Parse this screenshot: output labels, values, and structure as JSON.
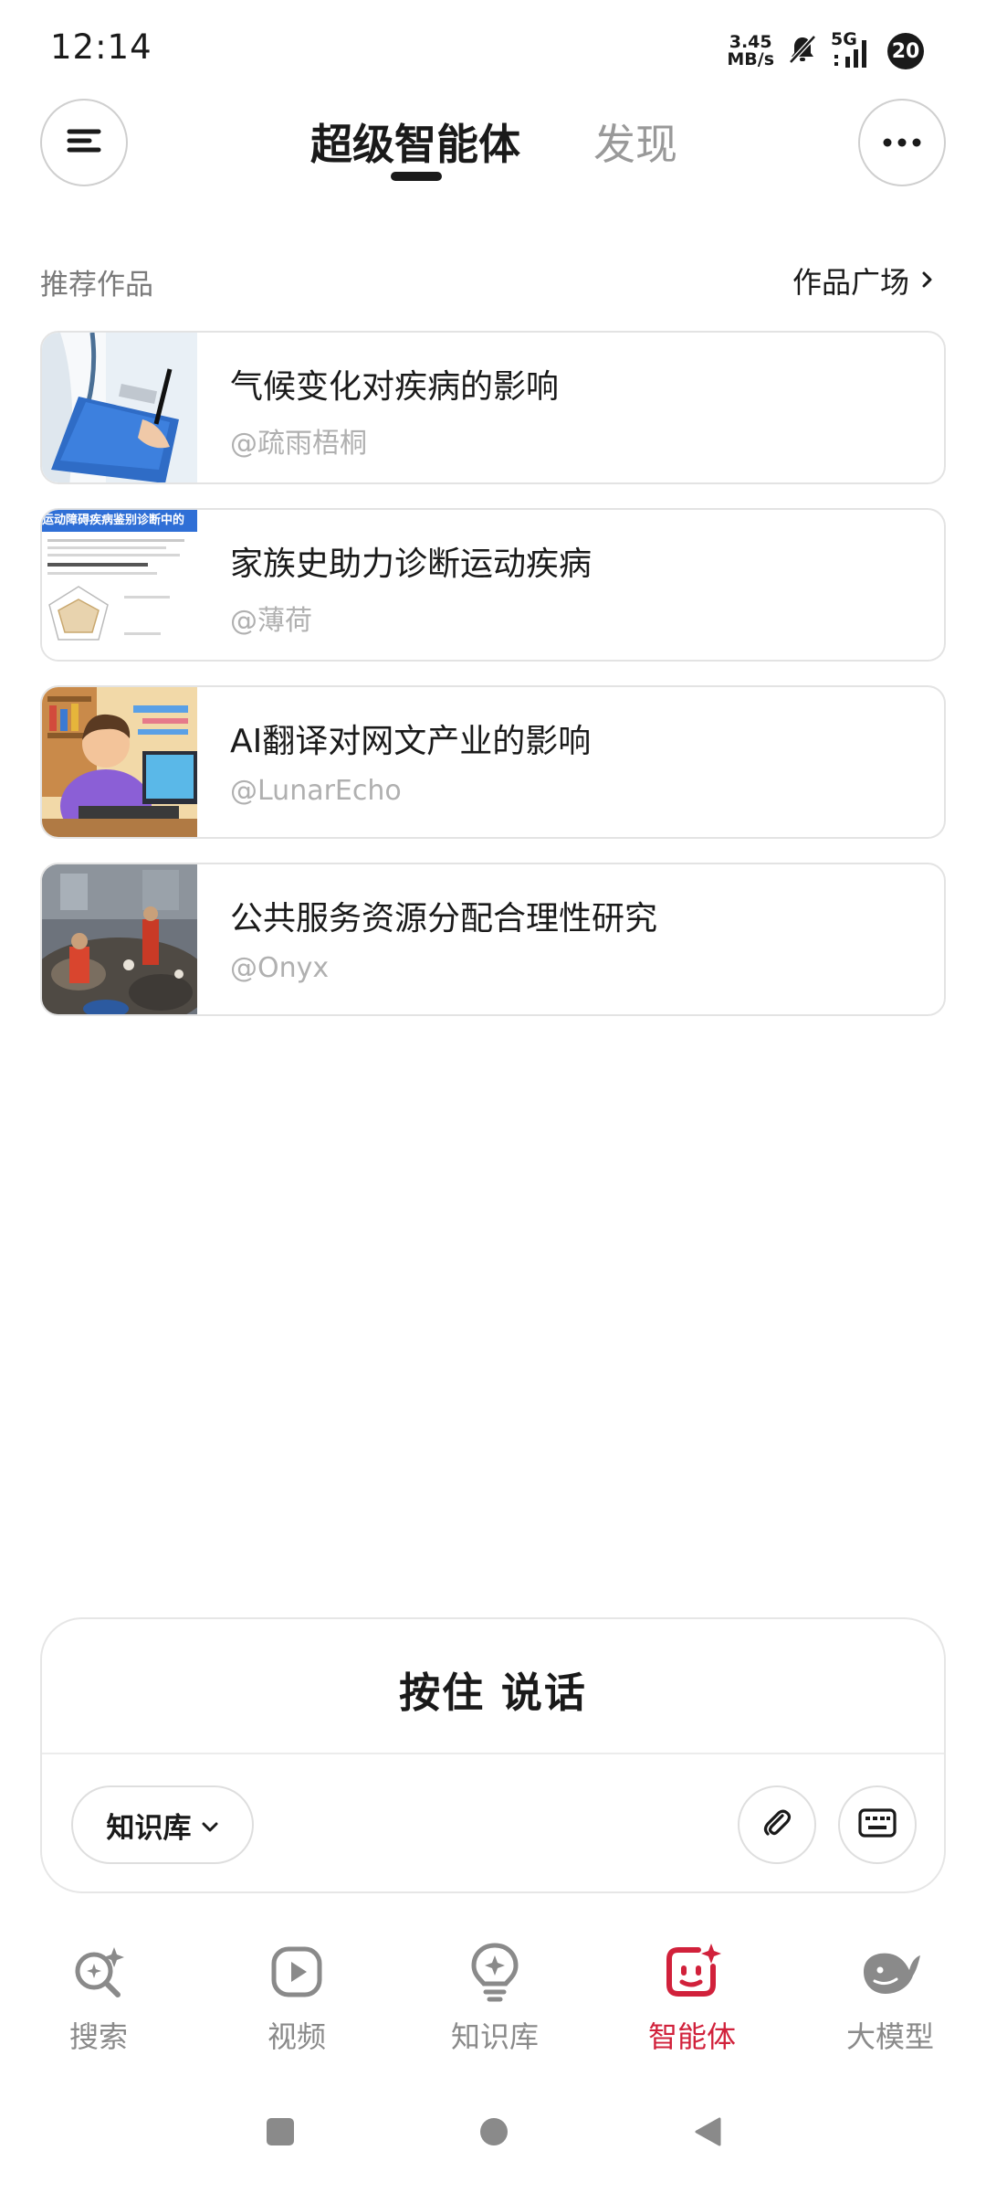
{
  "status_bar": {
    "time": "12:14",
    "net_speed_value": "3.45",
    "net_speed_unit": "MB/s",
    "network": "5G",
    "notification_count": "20"
  },
  "header": {
    "menu_icon": "menu-icon",
    "tab_active": "超级智能体",
    "tab_inactive": "发现",
    "more_icon": "more-icon"
  },
  "section": {
    "title": "推荐作品",
    "link_label": "作品广场",
    "link_icon": "chevron-right-icon"
  },
  "works": [
    {
      "title": "气候变化对疾病的影响",
      "author": "@疏雨梧桐"
    },
    {
      "title": "家族史助力诊断运动疾病",
      "author": "@薄荷",
      "thumb_caption": "运动障碍疾病鉴别诊断中的"
    },
    {
      "title": "AI翻译对网文产业的影响",
      "author": "@LunarEcho"
    },
    {
      "title": "公共服务资源分配合理性研究",
      "author": "@Onyx"
    }
  ],
  "input_panel": {
    "hold_to_talk": "按住 说话",
    "knowledge_base": "知识库",
    "attach_icon": "paperclip-icon",
    "keyboard_icon": "keyboard-icon"
  },
  "bottom_nav": [
    {
      "label": "搜索",
      "icon": "search-sparkle-icon",
      "active": false
    },
    {
      "label": "视频",
      "icon": "video-play-icon",
      "active": false
    },
    {
      "label": "知识库",
      "icon": "lightbulb-icon",
      "active": false
    },
    {
      "label": "智能体",
      "icon": "agent-face-icon",
      "active": true
    },
    {
      "label": "大模型",
      "icon": "whale-icon",
      "active": false
    }
  ],
  "colors": {
    "accent": "#d1213b",
    "text": "#1a1a1a",
    "muted": "#999999"
  }
}
